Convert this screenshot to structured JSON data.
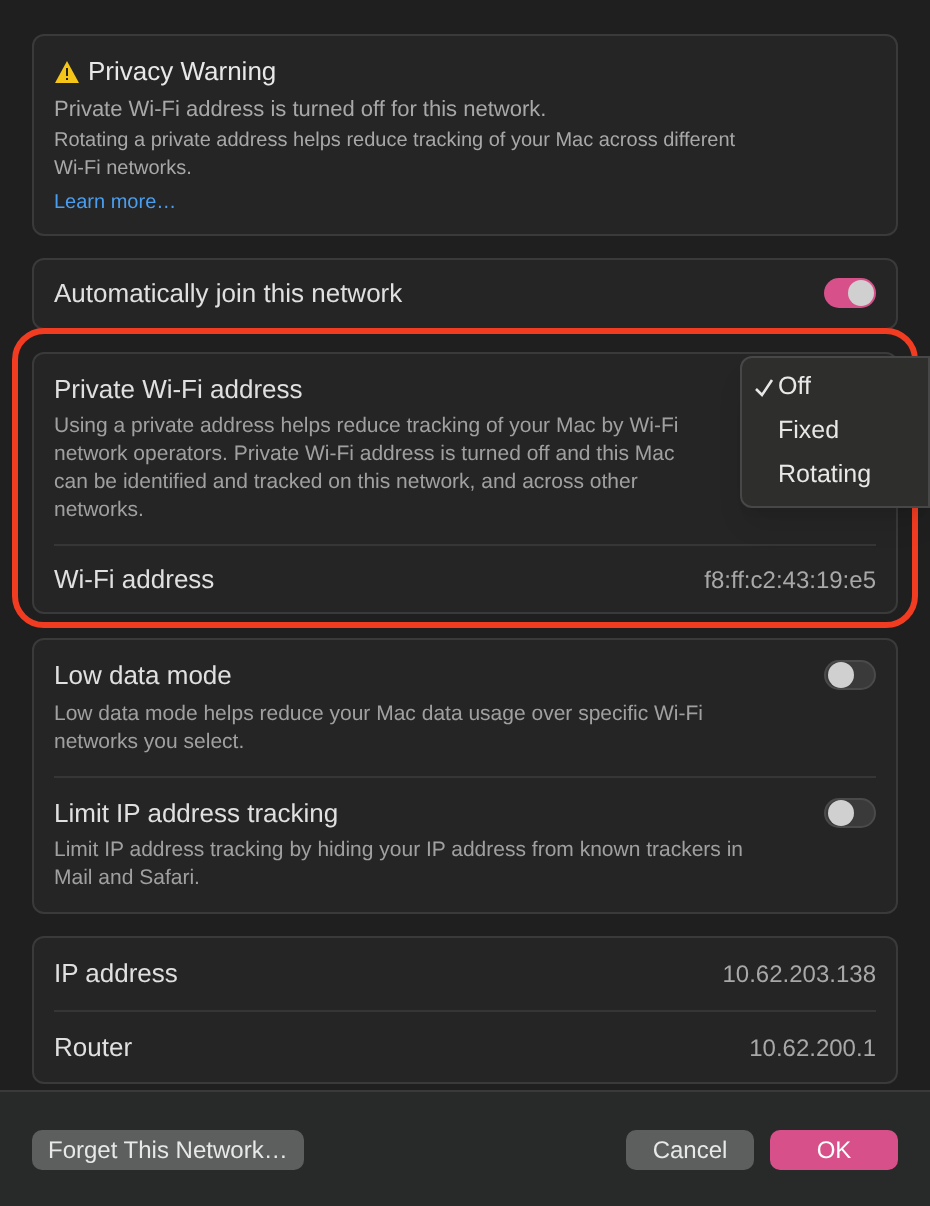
{
  "warning": {
    "title": "Privacy Warning",
    "lines": [
      "Private Wi-Fi address is turned off for this network.",
      "Rotating a private address helps reduce tracking of your Mac across different Wi-Fi networks."
    ],
    "link": "Learn more…"
  },
  "auto_join": {
    "label": "Automatically join this network",
    "on": true
  },
  "private_address": {
    "title": "Private Wi-Fi address",
    "description": "Using a private address helps reduce tracking of your Mac by Wi-Fi network operators. Private Wi-Fi address is turned off and this Mac can be identified and tracked on this network, and across other networks.",
    "menu": [
      {
        "label": "Off",
        "selected": true
      },
      {
        "label": "Fixed",
        "selected": false
      },
      {
        "label": "Rotating",
        "selected": false
      }
    ],
    "address_label": "Wi-Fi address",
    "address_value": "f8:ff:c2:43:19:e5"
  },
  "options": [
    {
      "title": "Low data mode",
      "description": "Low data mode helps reduce your Mac data usage over specific Wi-Fi networks you select.",
      "on": false
    },
    {
      "title": "Limit IP address tracking",
      "description": "Limit IP address tracking by hiding your IP address from known trackers in Mail and Safari.",
      "on": false
    }
  ],
  "info": [
    {
      "label": "IP address",
      "value": "10.62.203.138"
    },
    {
      "label": "Router",
      "value": "10.62.200.1"
    }
  ],
  "buttons": {
    "forget": "Forget This Network…",
    "cancel": "Cancel",
    "ok": "OK"
  }
}
